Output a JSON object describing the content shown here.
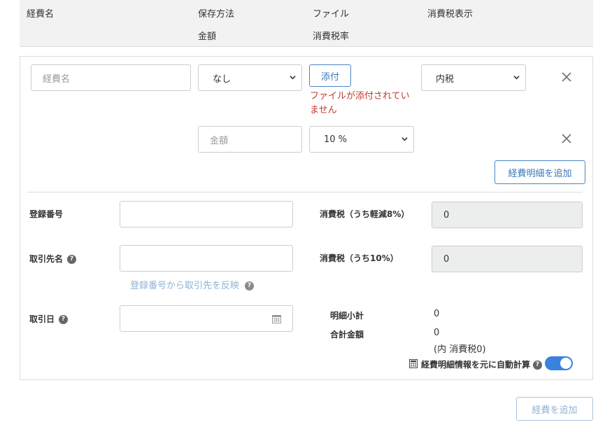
{
  "header": {
    "col_name": "経費名",
    "col_storage": "保存方法",
    "col_amount": "金額",
    "col_file": "ファイル",
    "col_tax_rate": "消費税率",
    "col_tax_display": "消費税表示"
  },
  "row1": {
    "name_placeholder": "経費名",
    "storage_value": "なし",
    "attach_label": "添付",
    "file_error_line1": "ファイルが添付されてい",
    "file_error_line2": "ません",
    "tax_display_value": "内税"
  },
  "row2": {
    "amount_placeholder": "金額",
    "tax_rate_value": "10 %"
  },
  "add_detail_label": "経費明細を追加",
  "form": {
    "reg_number_label": "登録番号",
    "reg_number_value": "",
    "partner_label": "取引先名",
    "partner_value": "",
    "reflect_link": "登録番号から取引先を反映",
    "date_label": "取引日",
    "date_value": "",
    "tax8_label": "消費税（うち軽減8%）",
    "tax8_value": "0",
    "tax10_label": "消費税（うち10%）",
    "tax10_value": "0",
    "subtotal_label": "明細小計",
    "subtotal_value": "0",
    "total_label": "合計金額",
    "total_value": "0",
    "total_tax_note": "(内 消費税0)",
    "auto_calc_label": "経費明細情報を元に自動計算",
    "auto_calc_on": true
  },
  "add_expense_label": "経費を追加",
  "colors": {
    "accent": "#3b78b8",
    "error": "#c0392b",
    "toggle": "#3b82e0"
  }
}
